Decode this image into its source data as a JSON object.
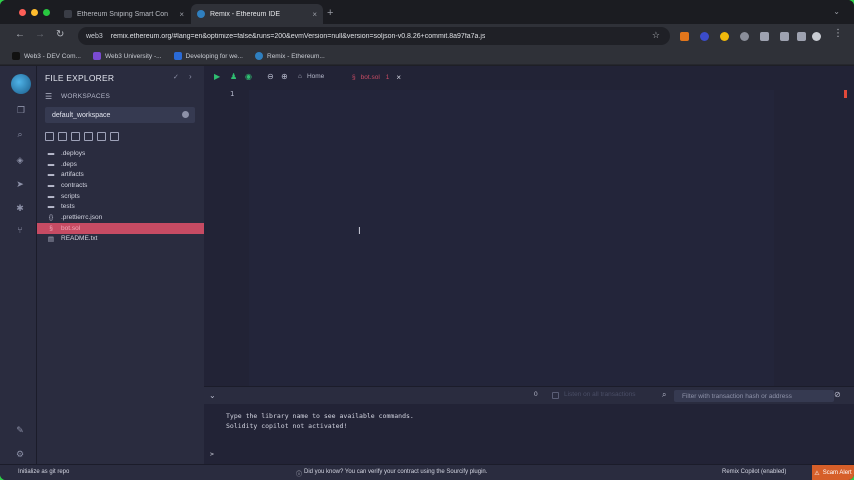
{
  "browser": {
    "tabs": [
      {
        "title": "Ethereum Sniping Smart Con",
        "favicon_color": "#3a3d46",
        "active": false
      },
      {
        "title": "Remix - Ethereum IDE",
        "favicon_color": "#2f7fbf",
        "active": true
      }
    ],
    "new_tab": "+",
    "close": "×",
    "address": {
      "site": "web3",
      "url": "remix.ethereum.org/#lang=en&optimize=false&runs=200&evmVersion=null&version=soljson-v0.8.26+commit.8a97fa7a.js"
    },
    "bookmarks": [
      {
        "label": "Web3 - DEV Com...",
        "icon_color": "#111111"
      },
      {
        "label": "Web3 University -...",
        "icon_color": "#7a4bd1"
      },
      {
        "label": "Developing for we...",
        "icon_color": "#2a6ad6"
      },
      {
        "label": "Remix - Ethereum...",
        "icon_color": "#2f7fbf"
      }
    ]
  },
  "remix": {
    "file_explorer": {
      "title": "FILE EXPLORER",
      "workspaces_label": "WORKSPACES",
      "workspace": "default_workspace",
      "tree": [
        {
          "name": ".deploys",
          "kind": "folder"
        },
        {
          "name": ".deps",
          "kind": "folder"
        },
        {
          "name": "artifacts",
          "kind": "folder"
        },
        {
          "name": "contracts",
          "kind": "folder"
        },
        {
          "name": "scripts",
          "kind": "folder"
        },
        {
          "name": "tests",
          "kind": "folder"
        },
        {
          "name": ".prettierrc.json",
          "kind": "file"
        },
        {
          "name": "bot.sol",
          "kind": "sol",
          "selected": true
        },
        {
          "name": "README.txt",
          "kind": "file"
        }
      ]
    },
    "editor": {
      "home_tab": "Home",
      "file_tab": "bot.sol",
      "file_tab_badge": "1",
      "line_number": "1"
    },
    "terminal": {
      "counter": "0",
      "listen_label": "Listen on all transactions",
      "filter_placeholder": "Filter with transaction hash or address",
      "lines": [
        "Type the library name to see available commands.",
        "Solidity copilot not activated!"
      ],
      "prompt": ">"
    },
    "statusbar": {
      "left": "Initialize as git repo",
      "tip": "Did you know?   You can verify your contract using the Sourcify plugin.",
      "copilot": "Remix Copilot (enabled)",
      "scam": "Scam Alert"
    }
  },
  "colors": {
    "accent": "#c64b63",
    "scam": "#d65f29",
    "run": "#2fbf71"
  }
}
